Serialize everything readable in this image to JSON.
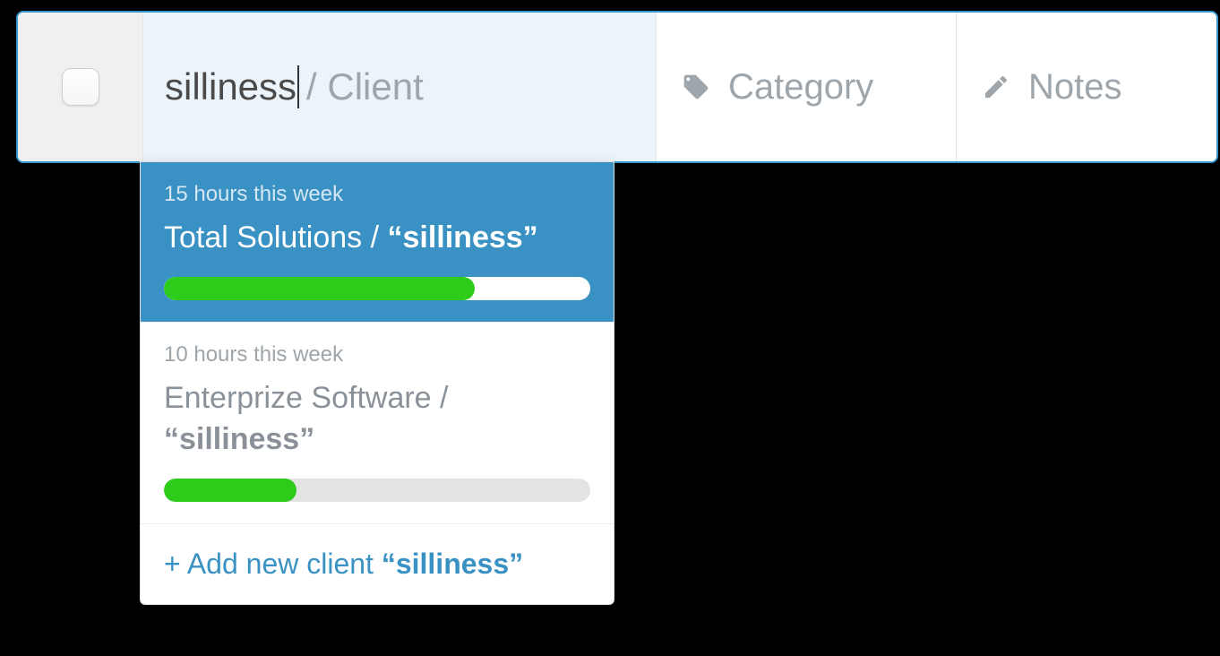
{
  "input": {
    "typed_value": "silliness",
    "placeholder_suffix": " / Client"
  },
  "columns": {
    "category_label": "Category",
    "notes_label": "Notes"
  },
  "dropdown": {
    "items": [
      {
        "meta": "15 hours this week",
        "client": "Total Solutions",
        "separator": " / ",
        "quoted": "“silliness”",
        "progress_percent": 73,
        "selected": true
      },
      {
        "meta": "10 hours this week",
        "client": "Enterprize Software",
        "separator": " / ",
        "quoted": "“silliness”",
        "progress_percent": 31,
        "selected": false
      }
    ],
    "add_new_prefix": "+ Add new client ",
    "add_new_quoted": "“silliness”"
  }
}
